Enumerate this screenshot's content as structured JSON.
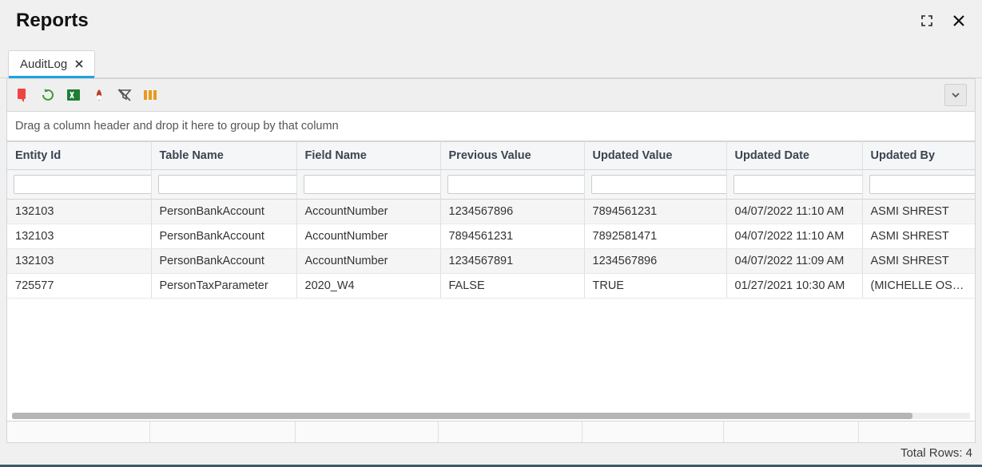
{
  "header": {
    "title": "Reports"
  },
  "tabs": [
    {
      "label": "AuditLog",
      "active": true
    }
  ],
  "groupbar_text": "Drag a column header and drop it here to group by that column",
  "columns": [
    {
      "key": "entity_id",
      "header": "Entity Id"
    },
    {
      "key": "table_name",
      "header": "Table Name"
    },
    {
      "key": "field_name",
      "header": "Field Name"
    },
    {
      "key": "previous_value",
      "header": "Previous Value"
    },
    {
      "key": "updated_value",
      "header": "Updated Value"
    },
    {
      "key": "updated_date",
      "header": "Updated Date"
    },
    {
      "key": "updated_by",
      "header": "Updated By"
    }
  ],
  "rows": [
    {
      "entity_id": "132103",
      "table_name": "PersonBankAccount",
      "field_name": "AccountNumber",
      "previous_value": "1234567896",
      "updated_value": "7894561231",
      "updated_date": "04/07/2022 11:10 AM",
      "updated_by": "ASMI    SHREST"
    },
    {
      "entity_id": "132103",
      "table_name": "PersonBankAccount",
      "field_name": "AccountNumber",
      "previous_value": "7894561231",
      "updated_value": "7892581471",
      "updated_date": "04/07/2022 11:10 AM",
      "updated_by": "ASMI    SHREST"
    },
    {
      "entity_id": "132103",
      "table_name": "PersonBankAccount",
      "field_name": "AccountNumber",
      "previous_value": "1234567891",
      "updated_value": "1234567896",
      "updated_date": "04/07/2022 11:09 AM",
      "updated_by": "ASMI    SHREST"
    },
    {
      "entity_id": "725577",
      "table_name": "PersonTaxParameter",
      "field_name": "2020_W4",
      "previous_value": "FALSE",
      "updated_value": "TRUE",
      "updated_date": "01/27/2021 10:30 AM",
      "updated_by": "(MICHELLE OSLEN)"
    }
  ],
  "footer": {
    "total_rows_label": "Total Rows:",
    "total_rows_value": "4"
  }
}
